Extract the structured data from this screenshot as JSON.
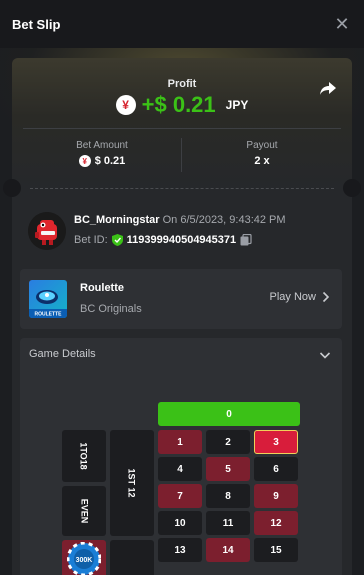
{
  "header": {
    "title": "Bet Slip"
  },
  "profit": {
    "label": "Profit",
    "value": "+$ 0.21",
    "currency": "JPY",
    "icon": "yen-icon"
  },
  "bet_amount": {
    "label": "Bet Amount",
    "value": "$ 0.21"
  },
  "payout": {
    "label": "Payout",
    "value": "2 x"
  },
  "user": {
    "name": "BC_Morningstar",
    "on_text": "On 6/5/2023, 9:43:42 PM",
    "bet_id_label": "Bet ID:",
    "bet_id": "119399940504945371"
  },
  "game": {
    "title": "Roulette",
    "subtitle": "BC Originals",
    "play_label": "Play Now",
    "thumb_text": "ROULETTE"
  },
  "details": {
    "label": "Game Details"
  },
  "board": {
    "zero": "0",
    "side_top": "1TO18",
    "side_mid": "1ST 12",
    "side_bottom": "EVEN",
    "rows": [
      [
        {
          "n": "1",
          "c": "red"
        },
        {
          "n": "2",
          "c": "black"
        },
        {
          "n": "3",
          "c": "hit"
        }
      ],
      [
        {
          "n": "4",
          "c": "black"
        },
        {
          "n": "5",
          "c": "red"
        },
        {
          "n": "6",
          "c": "black"
        }
      ],
      [
        {
          "n": "7",
          "c": "red"
        },
        {
          "n": "8",
          "c": "black"
        },
        {
          "n": "9",
          "c": "red"
        }
      ],
      [
        {
          "n": "10",
          "c": "black"
        },
        {
          "n": "11",
          "c": "black"
        },
        {
          "n": "12",
          "c": "red"
        }
      ],
      [
        {
          "n": "13",
          "c": "black"
        },
        {
          "n": "14",
          "c": "red"
        },
        {
          "n": "15",
          "c": "black"
        }
      ]
    ],
    "chip_text": "300K"
  },
  "colors": {
    "accent_green": "#3bc117",
    "red": "#d81d3b",
    "bg": "#1c1e21"
  }
}
